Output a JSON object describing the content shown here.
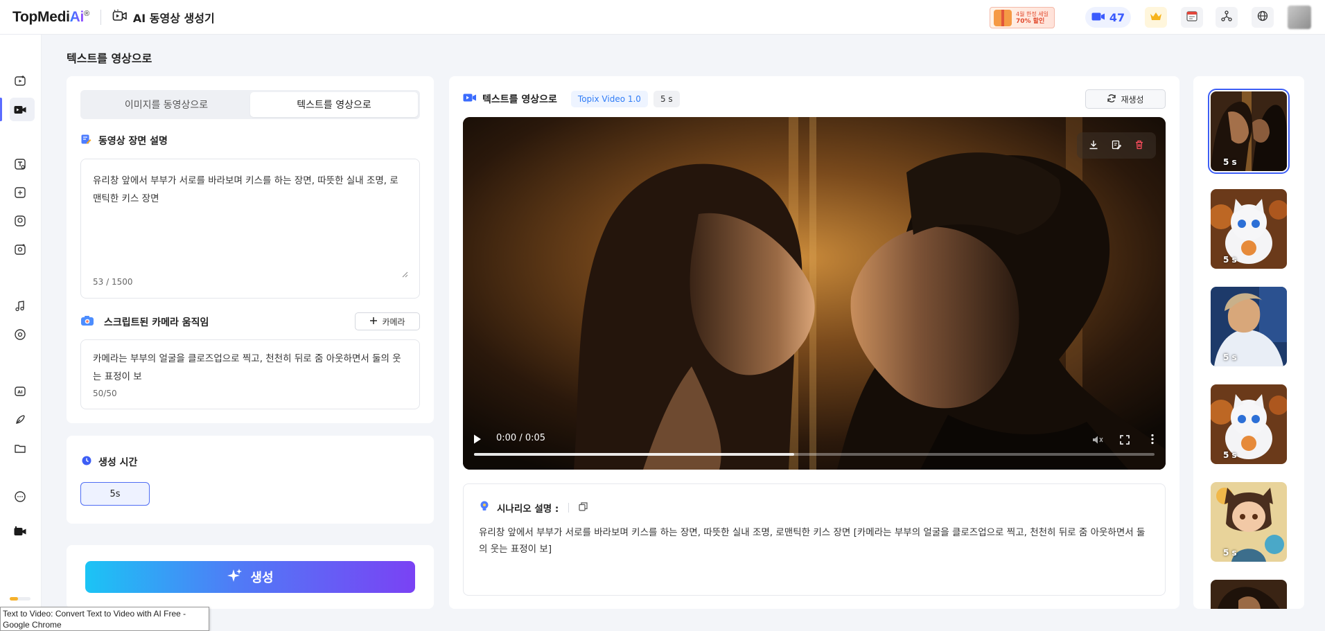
{
  "header": {
    "logo_text_a": "TopMedi",
    "logo_text_b": "Ai",
    "logo_reg": "®",
    "title": "AI 동영상 생성기",
    "promo_line1": "4월 한정 세일",
    "promo_line2": "70% 할인",
    "credits": "47"
  },
  "page": {
    "title": "텍스트를 영상으로"
  },
  "left": {
    "tabs": [
      {
        "label": "이미지를 동영상으로",
        "active": false
      },
      {
        "label": "텍스트를 영상으로",
        "active": true
      }
    ],
    "scene_title": "동영상 장면 설명",
    "scene_text": "유리창 앞에서 부부가 서로를 바라보며 키스를 하는 장면, 따뜻한 실내 조명, 로맨틱한 키스 장면",
    "scene_count": "53 / 1500",
    "camera_title": "스크립트된 카메라 움직임",
    "camera_button": "카메라",
    "camera_text": "카메라는 부부의 얼굴을 클로즈업으로 찍고, 천천히 뒤로 줌 아웃하면서 둘의 웃는 표정이 보",
    "camera_count": "50/50",
    "duration_title": "생성 시간",
    "duration_value": "5s",
    "generate_label": "생성"
  },
  "center": {
    "title": "텍스트를 영상으로",
    "model_badge": "Topix Video 1.0",
    "duration_badge": "5 s",
    "regenerate_label": "재생성",
    "video_time": "0:00 / 0:05",
    "video_progress": 0.47,
    "scenario_title": "시나리오 설명 :",
    "scenario_text": "유리창 앞에서 부부가 서로를 바라보며 키스를 하는 장면, 따뜻한 실내 조명, 로맨틱한 키스 장면 [카메라는 부부의 얼굴을 클로즈업으로 찍고, 천천히 뒤로 줌 아웃하면서 둘의 웃는 표정이 보]"
  },
  "thumbnails": [
    {
      "label": "5 s",
      "selected": true
    },
    {
      "label": "5 s",
      "selected": false
    },
    {
      "label": "5 s",
      "selected": false
    },
    {
      "label": "5 s",
      "selected": false
    },
    {
      "label": "5 s",
      "selected": false
    }
  ],
  "tooltip": {
    "line1": "Text to Video: Convert Text to Video with AI Free -",
    "line2": "Google Chrome"
  },
  "colors": {
    "accent": "#3d5ef5",
    "generate_gradient_start": "#1bc4f5",
    "generate_gradient_end": "#7a42f4"
  }
}
